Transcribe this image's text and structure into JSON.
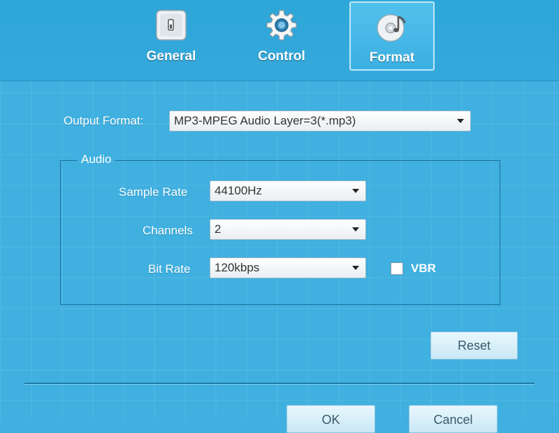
{
  "tabs": [
    {
      "label": "General",
      "icon": "switch-icon"
    },
    {
      "label": "Control",
      "icon": "gear-icon"
    },
    {
      "label": "Format",
      "icon": "disc-music-icon",
      "active": true
    }
  ],
  "format": {
    "output_label": "Output Format:",
    "output_value": "MP3-MPEG Audio Layer=3(*.mp3)"
  },
  "audio": {
    "group_title": "Audio",
    "sample_rate_label": "Sample Rate",
    "sample_rate_value": "44100Hz",
    "channels_label": "Channels",
    "channels_value": "2",
    "bit_rate_label": "Bit Rate",
    "bit_rate_value": "120kbps",
    "vbr_label": "VBR"
  },
  "buttons": {
    "reset": "Reset",
    "ok": "OK",
    "cancel": "Cancel"
  },
  "colors": {
    "background": "#3fb0e0",
    "active_tab": "#52c0ec",
    "group_border": "#1d6f96"
  }
}
